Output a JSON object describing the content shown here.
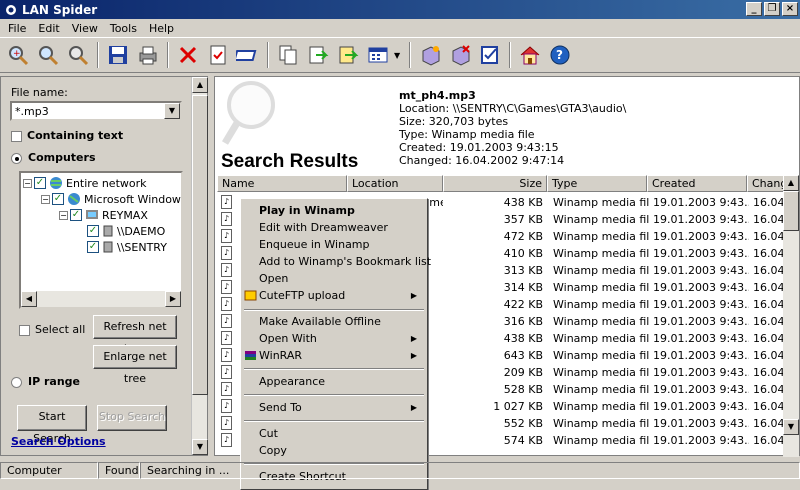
{
  "window": {
    "title": "LAN Spider"
  },
  "menu": [
    "File",
    "Edit",
    "View",
    "Tools",
    "Help"
  ],
  "toolbar_icons": [
    "magnifier-plus-icon",
    "magnifier-icon",
    "magnifier-minus-icon",
    "save-icon",
    "print-icon",
    "delete-icon",
    "properties-icon",
    "rename-icon",
    "copy-icon",
    "move-icon",
    "export-icon",
    "view-icon",
    "dropdown-arrow-icon",
    "add-file-icon",
    "remove-file-icon",
    "check-icon",
    "home-icon",
    "help-icon"
  ],
  "left": {
    "filename_label": "File name:",
    "filename_value": "*.mp3",
    "containing_text": "Containing text",
    "computers": "Computers",
    "tree": [
      "Entire network",
      "Microsoft Window",
      "REYMAX",
      "\\\\DAEMO",
      "\\\\SENTRY"
    ],
    "select_all": "Select all",
    "refresh_btn": "Refresh net tree",
    "enlarge_btn": "Enlarge net tree",
    "ip_range": "IP range",
    "start_btn": "Start Search",
    "stop_btn": "Stop Search",
    "search_options": "Search Options"
  },
  "preview": {
    "title": "Search Results",
    "filename": "mt_ph4.mp3",
    "location": "Location: \\\\SENTRY\\C\\Games\\GTA3\\audio\\",
    "size": "Size: 320,703 bytes",
    "type": "Type: Winamp media file",
    "created": "Created: 19.01.2003 9:43:15",
    "changed": "Changed: 16.04.2002 9:47:14"
  },
  "columns": [
    "Name",
    "Location",
    "Size",
    "Type",
    "Created",
    "Chang"
  ],
  "rows": [
    {
      "name": "",
      "location": "\\\\SENTRY\\C\\Games\\...",
      "size": "438 KB",
      "type": "Winamp media file",
      "created": "19.01.2003 9:43...",
      "changed": "16.04."
    },
    {
      "name": "",
      "location": "Games\\...",
      "size": "357 KB",
      "type": "Winamp media file",
      "created": "19.01.2003 9:43...",
      "changed": "16.04."
    },
    {
      "name": "",
      "location": "Games\\...",
      "size": "472 KB",
      "type": "Winamp media file",
      "created": "19.01.2003 9:43...",
      "changed": "16.04."
    },
    {
      "name": "",
      "location": "Games\\...",
      "size": "410 KB",
      "type": "Winamp media file",
      "created": "19.01.2003 9:43...",
      "changed": "16.04."
    },
    {
      "name": "",
      "location": "Games\\...",
      "size": "313 KB",
      "type": "Winamp media file",
      "created": "19.01.2003 9:43...",
      "changed": "16.04."
    },
    {
      "name": "",
      "location": "Games\\...",
      "size": "314 KB",
      "type": "Winamp media file",
      "created": "19.01.2003 9:43...",
      "changed": "16.04."
    },
    {
      "name": "",
      "location": "Games\\...",
      "size": "422 KB",
      "type": "Winamp media file",
      "created": "19.01.2003 9:43...",
      "changed": "16.04."
    },
    {
      "name": "",
      "location": "Games\\...",
      "size": "316 KB",
      "type": "Winamp media file",
      "created": "19.01.2003 9:43...",
      "changed": "16.04."
    },
    {
      "name": "",
      "location": "Games\\...",
      "size": "438 KB",
      "type": "Winamp media file",
      "created": "19.01.2003 9:43...",
      "changed": "16.04."
    },
    {
      "name": "",
      "location": "Games\\...",
      "size": "643 KB",
      "type": "Winamp media file",
      "created": "19.01.2003 9:43...",
      "changed": "16.04."
    },
    {
      "name": "",
      "location": "Games\\...",
      "size": "209 KB",
      "type": "Winamp media file",
      "created": "19.01.2003 9:43...",
      "changed": "16.04."
    },
    {
      "name": "",
      "location": "Games\\...",
      "size": "528 KB",
      "type": "Winamp media file",
      "created": "19.01.2003 9:43...",
      "changed": "16.04."
    },
    {
      "name": "",
      "location": "Games\\...",
      "size": "1 027 KB",
      "type": "Winamp media file",
      "created": "19.01.2003 9:43...",
      "changed": "16.04."
    },
    {
      "name": "",
      "location": "Games\\...",
      "size": "552 KB",
      "type": "Winamp media file",
      "created": "19.01.2003 9:43...",
      "changed": "16.04."
    },
    {
      "name": "",
      "location": "Games\\...",
      "size": "574 KB",
      "type": "Winamp media file",
      "created": "19.01.2003 9:43...",
      "changed": "16.04."
    }
  ],
  "context_menu": [
    "Play in Winamp",
    "Edit with Dreamweaver",
    "Enqueue in Winamp",
    "Add to Winamp's Bookmark list",
    "Open",
    "CuteFTP upload",
    "Make Available Offline",
    "Open With",
    "WinRAR",
    "Appearance",
    "Send To",
    "Cut",
    "Copy",
    "Create Shortcut"
  ],
  "status": [
    "Computer",
    "Found",
    "Searching in ..."
  ],
  "colors": {
    "titlebar": "#0a246a",
    "link": "#0000a0"
  }
}
